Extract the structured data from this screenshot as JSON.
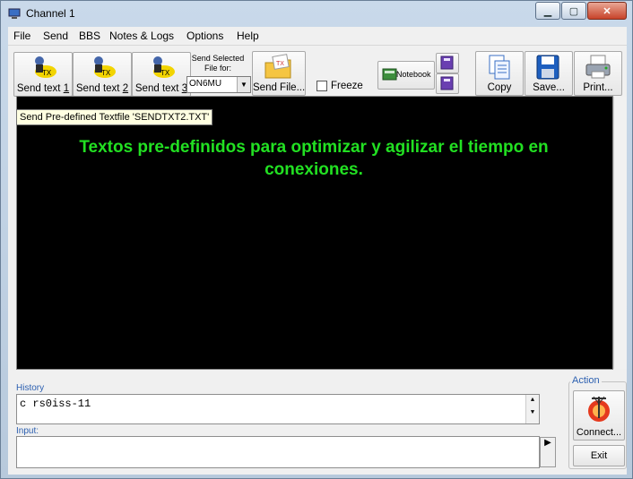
{
  "window": {
    "title": "Channel 1"
  },
  "menu": [
    "File",
    "Send",
    "BBS",
    "Notes & Logs",
    "Options",
    "Help"
  ],
  "toolbar": {
    "send_text_1": {
      "prefix": "Send text ",
      "num": "1"
    },
    "send_text_2": {
      "prefix": "Send text ",
      "num": "2"
    },
    "send_text_3": {
      "prefix": "Send text ",
      "num": "3"
    },
    "send_selected_label": "Send Selected File for:",
    "callsign_value": "ON6MU",
    "send_file": "Send File...",
    "freeze": "Freeze",
    "notebook": "Notebook",
    "copy": "Copy",
    "save": "Save...",
    "print": "Print..."
  },
  "tooltip": "Send Pre-defined Textfile 'SENDTXT2.TXT'",
  "terminal": {
    "overlay_text": "Textos pre-definidos para optimizar y agilizar el tiempo en conexiones."
  },
  "history": {
    "label": "History",
    "value": "c rs0iss-11"
  },
  "input": {
    "label": "Input:",
    "value": ""
  },
  "action": {
    "label": "Action",
    "connect": "Connect...",
    "exit": "Exit"
  },
  "colors": {
    "terminal_bg": "#000000",
    "overlay_text": "#22e022",
    "label_blue": "#2b5fb0"
  }
}
